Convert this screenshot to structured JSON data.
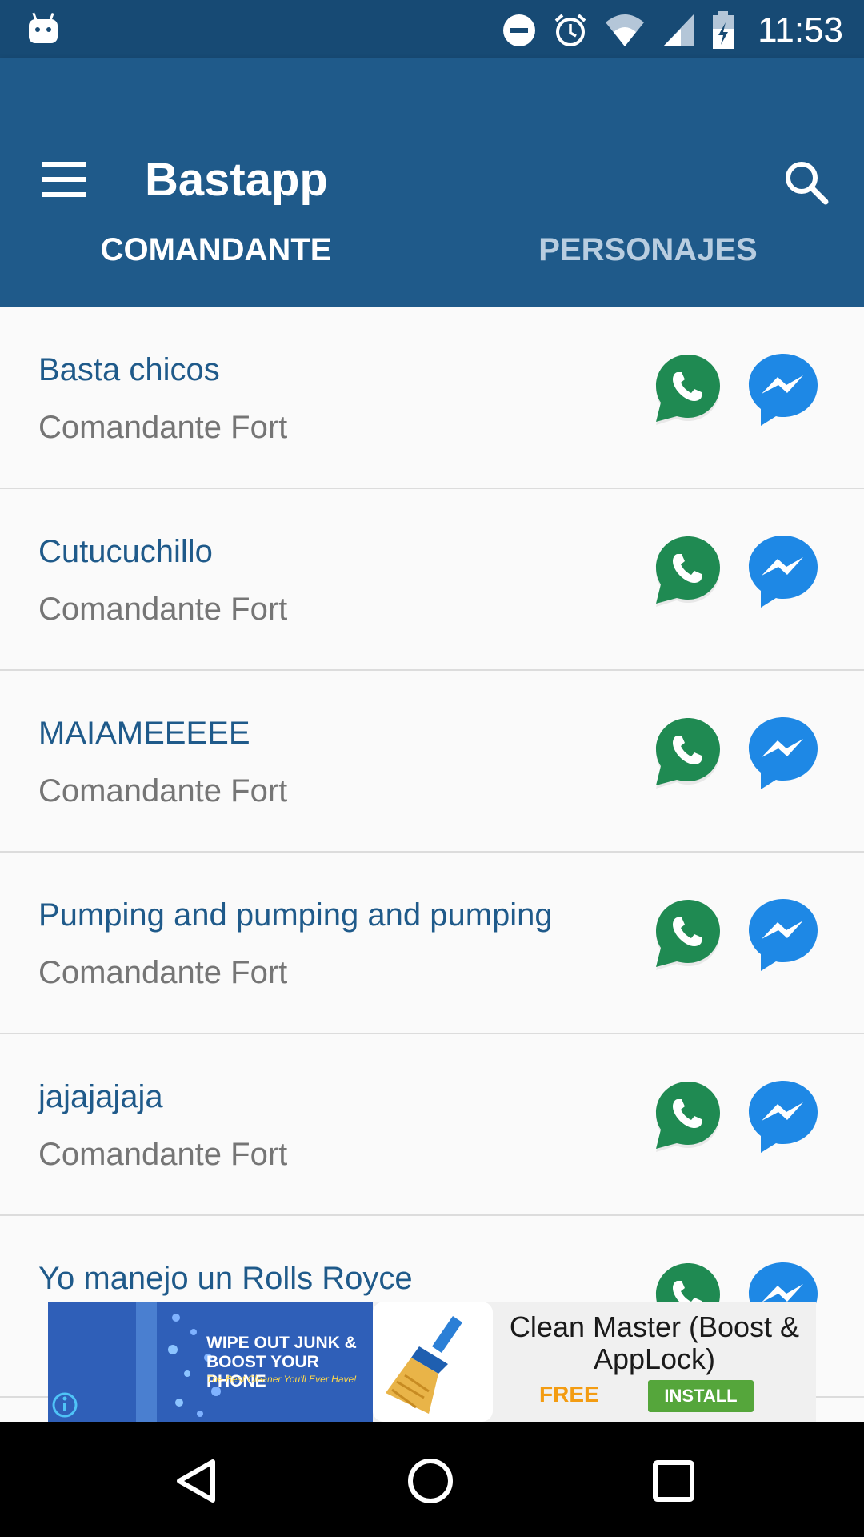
{
  "status_bar": {
    "time": "11:53",
    "icons": [
      "android-icon",
      "do-not-disturb-icon",
      "alarm-icon",
      "wifi-icon",
      "signal-icon",
      "battery-icon"
    ]
  },
  "app_bar": {
    "title": "Bastapp",
    "menu_icon": "menu-icon",
    "search_icon": "search-icon",
    "color": "#1f5a8a",
    "status_color": "#174a74"
  },
  "tabs": [
    {
      "label": "COMANDANTE",
      "selected": true
    },
    {
      "label": "PERSONAJES",
      "selected": false
    }
  ],
  "list": {
    "items": [
      {
        "title": "Basta chicos",
        "subtitle": "Comandante Fort"
      },
      {
        "title": "Cutucuchillo",
        "subtitle": "Comandante Fort"
      },
      {
        "title": "MAIAMEEEEE",
        "subtitle": "Comandante Fort"
      },
      {
        "title": "Pumping and pumping and pumping",
        "subtitle": "Comandante Fort"
      },
      {
        "title": "jajajajaja",
        "subtitle": "Comandante Fort"
      },
      {
        "title": "Yo manejo un Rolls Royce",
        "subtitle": ""
      }
    ],
    "share_icons": [
      "whatsapp-icon",
      "messenger-icon"
    ]
  },
  "ad": {
    "headline_line1": "WIPE OUT JUNK &",
    "headline_line2": "BOOST YOUR PHONE",
    "tagline": "The Best Cleaner You'll Ever Have!",
    "app_name": "Clean Master (Boost & AppLock)",
    "price": "FREE",
    "install_label": "INSTALL"
  },
  "nav_bar": {
    "icons": [
      "back-icon",
      "home-icon",
      "recent-apps-icon"
    ]
  }
}
